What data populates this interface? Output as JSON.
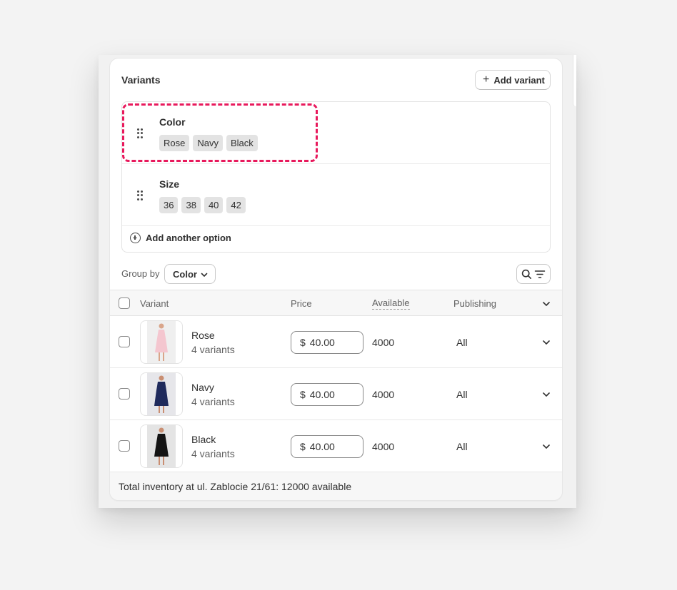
{
  "card": {
    "title": "Variants",
    "add_variant_label": "Add variant"
  },
  "options": [
    {
      "name": "Color",
      "values": [
        "Rose",
        "Navy",
        "Black"
      ]
    },
    {
      "name": "Size",
      "values": [
        "36",
        "38",
        "40",
        "42"
      ]
    }
  ],
  "add_option_label": "Add another option",
  "group_by": {
    "label": "Group by",
    "selected": "Color"
  },
  "table": {
    "headers": {
      "variant": "Variant",
      "price": "Price",
      "available": "Available",
      "publishing": "Publishing"
    },
    "rows": [
      {
        "name": "Rose",
        "count": "4 variants",
        "currency": "$",
        "price": "40.00",
        "available": "4000",
        "publishing": "All",
        "swatch": "#f4c6cf"
      },
      {
        "name": "Navy",
        "count": "4 variants",
        "currency": "$",
        "price": "40.00",
        "available": "4000",
        "publishing": "All",
        "swatch": "#1f2a5c"
      },
      {
        "name": "Black",
        "count": "4 variants",
        "currency": "$",
        "price": "40.00",
        "available": "4000",
        "publishing": "All",
        "swatch": "#141414"
      }
    ]
  },
  "footer": {
    "total_text": "Total inventory at ul. Zablocie 21/61: 12000 available"
  },
  "colors": {
    "highlight": "#e8195c",
    "chip_bg": "#e3e3e3"
  },
  "icons": [
    "plus-icon",
    "drag-handle-icon",
    "plus-circle-icon",
    "chevron-down-icon",
    "search-icon",
    "filter-icon"
  ]
}
